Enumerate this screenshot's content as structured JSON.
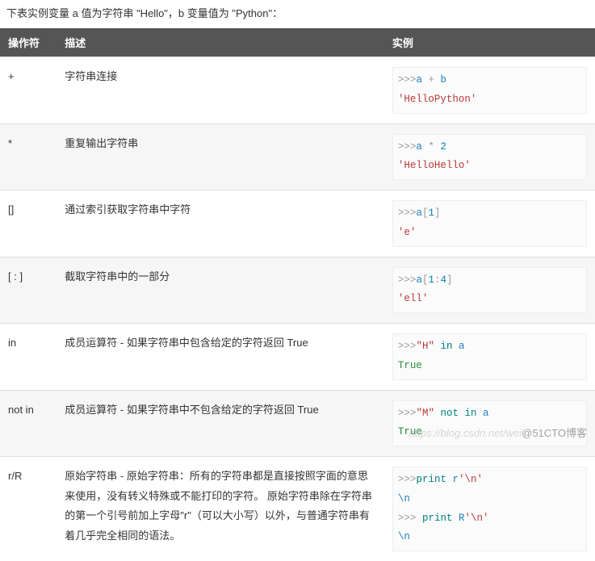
{
  "intro": "下表实例变量 a 值为字符串 \"Hello\"，b 变量值为 \"Python\"：",
  "headers": {
    "op": "操作符",
    "desc": "描述",
    "ex": "实例"
  },
  "rows": [
    {
      "op": "+",
      "desc": "字符串连接",
      "code": [
        [
          {
            "t": ">>>",
            "c": "prompt"
          },
          {
            "t": "a ",
            "c": "var"
          },
          {
            "t": "+",
            "c": "op"
          },
          {
            "t": " b",
            "c": "var"
          }
        ],
        [
          {
            "t": "'HelloPython'",
            "c": "str"
          }
        ]
      ]
    },
    {
      "op": "*",
      "desc": "重复输出字符串",
      "code": [
        [
          {
            "t": ">>>",
            "c": "prompt"
          },
          {
            "t": "a ",
            "c": "var"
          },
          {
            "t": "*",
            "c": "op"
          },
          {
            "t": " 2",
            "c": "num"
          }
        ],
        [
          {
            "t": "'HelloHello'",
            "c": "str"
          }
        ]
      ]
    },
    {
      "op": "[]",
      "desc": "通过索引获取字符串中字符",
      "code": [
        [
          {
            "t": ">>>",
            "c": "prompt"
          },
          {
            "t": "a",
            "c": "var"
          },
          {
            "t": "[",
            "c": "op"
          },
          {
            "t": "1",
            "c": "num"
          },
          {
            "t": "]",
            "c": "op"
          }
        ],
        [
          {
            "t": "'e'",
            "c": "str"
          }
        ]
      ]
    },
    {
      "op": "[ : ]",
      "desc": "截取字符串中的一部分",
      "code": [
        [
          {
            "t": ">>>",
            "c": "prompt"
          },
          {
            "t": "a",
            "c": "var"
          },
          {
            "t": "[",
            "c": "op"
          },
          {
            "t": "1",
            "c": "num"
          },
          {
            "t": ":",
            "c": "op"
          },
          {
            "t": "4",
            "c": "num"
          },
          {
            "t": "]",
            "c": "op"
          }
        ],
        [
          {
            "t": "'ell'",
            "c": "str"
          }
        ]
      ]
    },
    {
      "op": "in",
      "desc": "成员运算符 - 如果字符串中包含给定的字符返回 True",
      "code": [
        [
          {
            "t": ">>>",
            "c": "prompt"
          },
          {
            "t": "\"H\"",
            "c": "str"
          },
          {
            "t": " in ",
            "c": "kw"
          },
          {
            "t": "a",
            "c": "var"
          }
        ],
        [
          {
            "t": "True",
            "c": "out"
          }
        ]
      ]
    },
    {
      "op": "not in",
      "desc": "成员运算符 - 如果字符串中不包含给定的字符返回 True",
      "code": [
        [
          {
            "t": ">>>",
            "c": "prompt"
          },
          {
            "t": "\"M\"",
            "c": "str"
          },
          {
            "t": " not in ",
            "c": "kw"
          },
          {
            "t": "a",
            "c": "var"
          }
        ],
        [
          {
            "t": "True",
            "c": "out"
          }
        ]
      ]
    },
    {
      "op": "r/R",
      "desc": "原始字符串 - 原始字符串：所有的字符串都是直接按照字面的意思来使用，没有转义特殊或不能打印的字符。 原始字符串除在字符串的第一个引号前加上字母\"r\"（可以大小写）以外，与普通字符串有着几乎完全相同的语法。",
      "code": [
        [
          {
            "t": ">>>",
            "c": "prompt"
          },
          {
            "t": "print ",
            "c": "kw"
          },
          {
            "t": "r",
            "c": "var"
          },
          {
            "t": "'\\n'",
            "c": "str"
          }
        ],
        [
          {
            "t": "\\n",
            "c": "var"
          }
        ],
        [
          {
            "t": ">>> ",
            "c": "prompt"
          },
          {
            "t": "print ",
            "c": "kw"
          },
          {
            "t": "R",
            "c": "var"
          },
          {
            "t": "'\\n'",
            "c": "str"
          }
        ],
        [
          {
            "t": "\\n",
            "c": "var"
          }
        ]
      ]
    }
  ],
  "watermark": {
    "faint": "https://blog.csdn.net/wei",
    "strong": "@51CTO博客"
  }
}
